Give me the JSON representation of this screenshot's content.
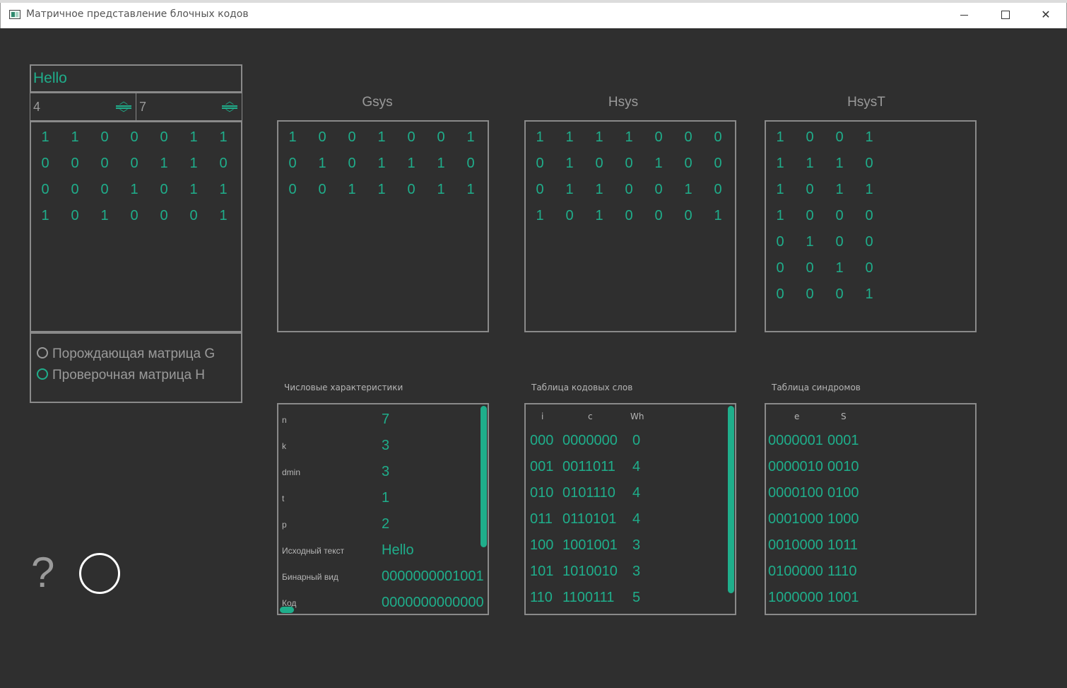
{
  "window": {
    "title": "Матричное представление блочных кодов",
    "controls": [
      "minimize",
      "maximize",
      "close"
    ]
  },
  "input": {
    "text": "Hello",
    "k": "4",
    "n": "7"
  },
  "entry_matrix": [
    [
      "1",
      "1",
      "0",
      "0",
      "0",
      "1",
      "1"
    ],
    [
      "0",
      "0",
      "0",
      "0",
      "1",
      "1",
      "0"
    ],
    [
      "0",
      "0",
      "0",
      "1",
      "0",
      "1",
      "1"
    ],
    [
      "1",
      "0",
      "1",
      "0",
      "0",
      "0",
      "1"
    ]
  ],
  "radios": [
    {
      "label": "Порождающая матрица G",
      "checked": false
    },
    {
      "label": "Проверочная матрица H",
      "checked": true
    }
  ],
  "gsys": {
    "title": "Gsys",
    "rows": [
      [
        "1",
        "0",
        "0",
        "1",
        "0",
        "0",
        "1"
      ],
      [
        "0",
        "1",
        "0",
        "1",
        "1",
        "1",
        "0"
      ],
      [
        "0",
        "0",
        "1",
        "1",
        "0",
        "1",
        "1"
      ]
    ]
  },
  "hsys": {
    "title": "Hsys",
    "rows": [
      [
        "1",
        "1",
        "1",
        "1",
        "0",
        "0",
        "0"
      ],
      [
        "0",
        "1",
        "0",
        "0",
        "1",
        "0",
        "0"
      ],
      [
        "0",
        "1",
        "1",
        "0",
        "0",
        "1",
        "0"
      ],
      [
        "1",
        "0",
        "1",
        "0",
        "0",
        "0",
        "1"
      ]
    ]
  },
  "hsyst": {
    "title": "HsysT",
    "rows": [
      [
        "1",
        "0",
        "0",
        "1"
      ],
      [
        "1",
        "1",
        "1",
        "0"
      ],
      [
        "1",
        "0",
        "1",
        "1"
      ],
      [
        "1",
        "0",
        "0",
        "0"
      ],
      [
        "0",
        "1",
        "0",
        "0"
      ],
      [
        "0",
        "0",
        "1",
        "0"
      ],
      [
        "0",
        "0",
        "0",
        "1"
      ]
    ]
  },
  "numeric": {
    "title": "Числовые характеристики",
    "rows": [
      {
        "label": "n",
        "value": "7"
      },
      {
        "label": "k",
        "value": "3"
      },
      {
        "label": "dmin",
        "value": "3"
      },
      {
        "label": "t",
        "value": "1"
      },
      {
        "label": "p",
        "value": "2"
      },
      {
        "label": "Исходный текст",
        "value": "Hello"
      },
      {
        "label": "Бинарный вид",
        "value": "0000000001001"
      },
      {
        "label": "Код",
        "value": "0000000000000"
      }
    ]
  },
  "codewords": {
    "title": "Таблица кодовых слов",
    "headers": [
      "i",
      "c",
      "Wh"
    ],
    "rows": [
      [
        "000",
        "0000000",
        "0"
      ],
      [
        "001",
        "0011011",
        "4"
      ],
      [
        "010",
        "0101110",
        "4"
      ],
      [
        "011",
        "0110101",
        "4"
      ],
      [
        "100",
        "1001001",
        "3"
      ],
      [
        "101",
        "1010010",
        "3"
      ],
      [
        "110",
        "1100111",
        "5"
      ]
    ]
  },
  "syndromes": {
    "title": "Таблица синдромов",
    "headers": [
      "e",
      "S"
    ],
    "rows": [
      [
        "0000001",
        "0001"
      ],
      [
        "0000010",
        "0010"
      ],
      [
        "0000100",
        "0100"
      ],
      [
        "0001000",
        "1000"
      ],
      [
        "0010000",
        "1011"
      ],
      [
        "0100000",
        "1110"
      ],
      [
        "1000000",
        "1001"
      ]
    ]
  },
  "bottom": {
    "help_label": "?"
  },
  "colors": {
    "background": "#2f2f2f",
    "accent": "#1fae8b",
    "text_gray": "#9a9a9a",
    "border": "#8a8a8a"
  }
}
